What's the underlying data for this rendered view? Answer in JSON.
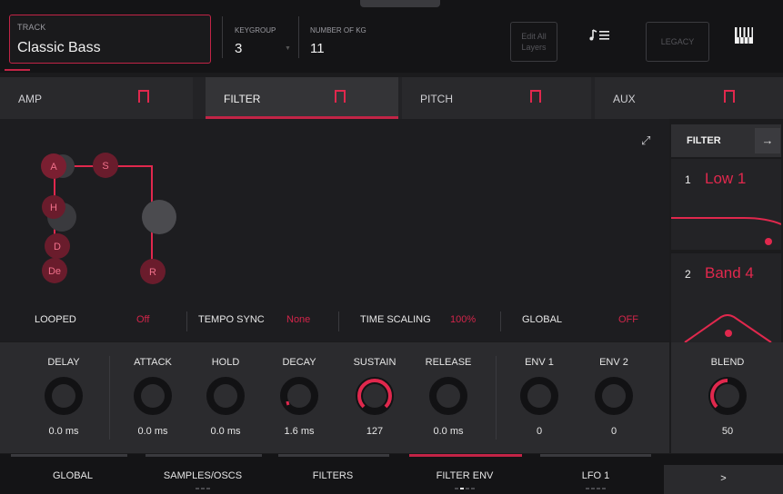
{
  "header": {
    "track": {
      "label": "TRACK",
      "value": "Classic Bass"
    },
    "keygroup": {
      "label": "KEYGROUP",
      "value": "3"
    },
    "number_of_kg": {
      "label": "NUMBER OF KG",
      "value": "11"
    },
    "edit_all_layers": "Edit All Layers",
    "edit_all_layers_line1": "Edit All",
    "edit_all_layers_line2": "Layers",
    "legacy": "LEGACY",
    "notes_icon": "note-list-icon",
    "piano_icon": "piano-keys-icon"
  },
  "tabs": [
    {
      "label": "AMP",
      "active": false
    },
    {
      "label": "FILTER",
      "active": true
    },
    {
      "label": "PITCH",
      "active": false
    },
    {
      "label": "AUX",
      "active": false
    }
  ],
  "envelope": {
    "nodes": [
      "A",
      "S",
      "H",
      "D",
      "De",
      "R"
    ]
  },
  "params": {
    "looped": {
      "label": "LOOPED",
      "value": "Off"
    },
    "tempo_sync": {
      "label": "TEMPO SYNC",
      "value": "None"
    },
    "time_scaling": {
      "label": "TIME SCALING",
      "value": "100%"
    },
    "global": {
      "label": "GLOBAL",
      "value": "OFF"
    }
  },
  "knobs": [
    {
      "label": "DELAY",
      "value": "0.0 ms",
      "level": 0
    },
    {
      "label": "ATTACK",
      "value": "0.0 ms",
      "level": 0
    },
    {
      "label": "HOLD",
      "value": "0.0 ms",
      "level": 0
    },
    {
      "label": "DECAY",
      "value": "1.6 ms",
      "level": 0.05
    },
    {
      "label": "SUSTAIN",
      "value": "127",
      "level": 1
    },
    {
      "label": "RELEASE",
      "value": "0.0 ms",
      "level": 0
    },
    {
      "label": "ENV 1",
      "value": "0",
      "level": 0
    },
    {
      "label": "ENV 2",
      "value": "0",
      "level": 0
    }
  ],
  "side": {
    "title": "FILTER",
    "slots": [
      {
        "num": "1",
        "name": "Low 1"
      },
      {
        "num": "2",
        "name": "Band 4"
      }
    ],
    "blend": {
      "label": "BLEND",
      "value": "50",
      "level": 0.5
    }
  },
  "bottom_nav": [
    {
      "label": "GLOBAL",
      "active": false,
      "dots": 0
    },
    {
      "label": "SAMPLES/OSCS",
      "active": false,
      "dots": 3
    },
    {
      "label": "FILTERS",
      "active": false,
      "dots": 0
    },
    {
      "label": "FILTER ENV",
      "active": true,
      "dots": 4
    },
    {
      "label": "LFO 1",
      "active": false,
      "dots": 4
    }
  ],
  "next_label": ">",
  "colors": {
    "accent": "#e0284d",
    "background": "#1b1b1d"
  }
}
